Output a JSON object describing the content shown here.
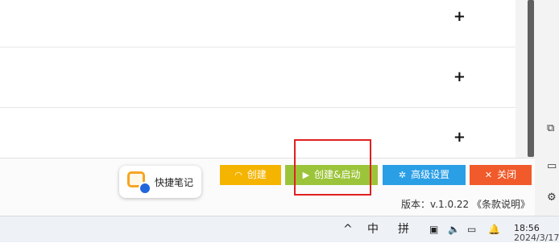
{
  "list": {
    "rows": [
      {
        "add_symbol": "+"
      },
      {
        "add_symbol": "+"
      },
      {
        "add_symbol": "+"
      }
    ]
  },
  "quick_note": {
    "label": "快捷笔记"
  },
  "toolbar": {
    "create_label": "创建",
    "create_start_label": "创建&启动",
    "advanced_label": "高级设置",
    "close_label": "关闭"
  },
  "footer": {
    "version_text": "版本：v.1.0.22 《条款说明》"
  },
  "taskbar": {
    "chevron": "^",
    "ime_lang": "中",
    "ime_mode": "拼",
    "time": "18:56",
    "date": "2024/3/17"
  },
  "colors": {
    "create": "#f5b400",
    "create_start": "#9cc43a",
    "advanced": "#2a9fe6",
    "close": "#f15a2a",
    "highlight": "#e02020"
  },
  "icons": {
    "create": "headset-icon",
    "create_start": "play-icon",
    "advanced": "gears-icon",
    "close": "close-icon",
    "side": [
      "screenshot-icon",
      "panel-icon",
      "settings-icon"
    ]
  }
}
